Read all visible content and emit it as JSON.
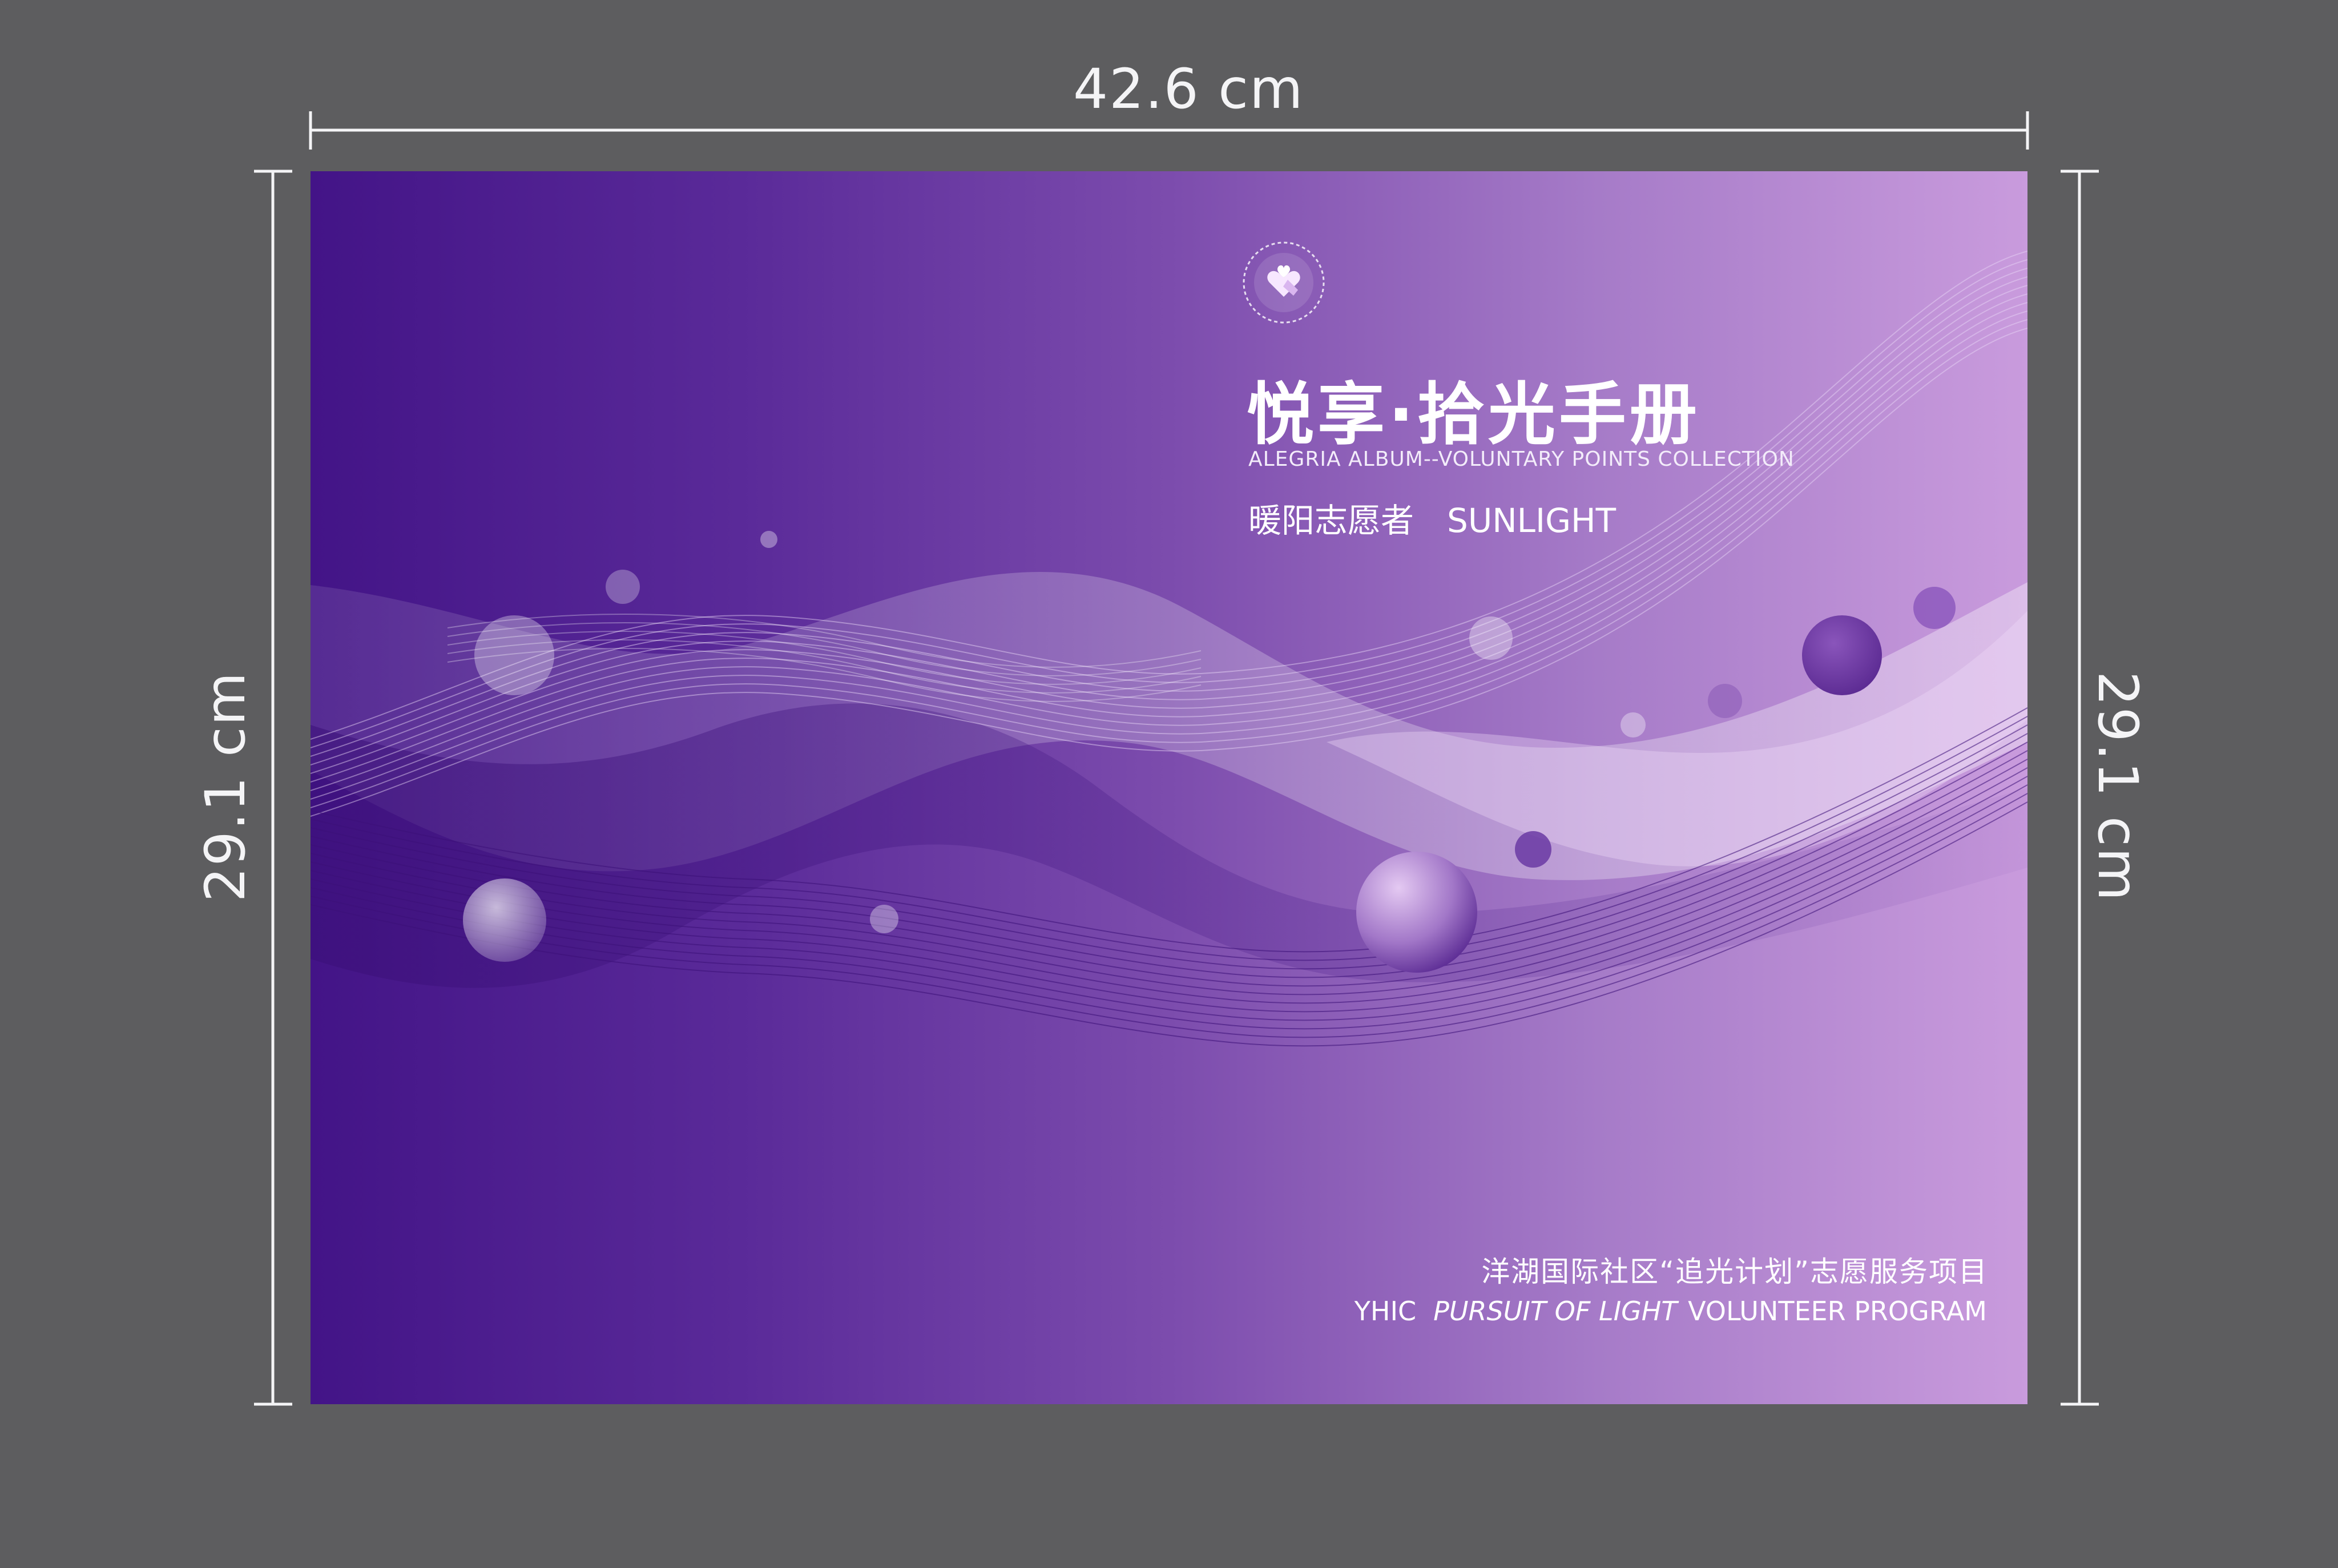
{
  "dimensions": {
    "width_label": "42.6 cm",
    "height_label_left": "29.1 cm",
    "height_label_right": "29.1 cm"
  },
  "cover": {
    "title": "悦享·拾光手册",
    "subtitle_en": "ALEGRIA ALBUM--VOLUNTARY POINTS COLLECTION",
    "group_cn": "暖阳志愿者",
    "group_en": "SUNLIGHT",
    "footer_cn": "洋湖国际社区“追光计划”志愿服务项目",
    "footer_en_prefix": "YHIC",
    "footer_en_italic": "PURSUIT OF LIGHT",
    "footer_en_suffix": "VOLUNTEER PROGRAM"
  },
  "colors": {
    "background": "#5d5d5f",
    "gradient_start": "#431487",
    "gradient_end": "#c99bdd",
    "text": "#ffffff"
  },
  "icons": {
    "logo": "heart-hands-logo-icon"
  }
}
